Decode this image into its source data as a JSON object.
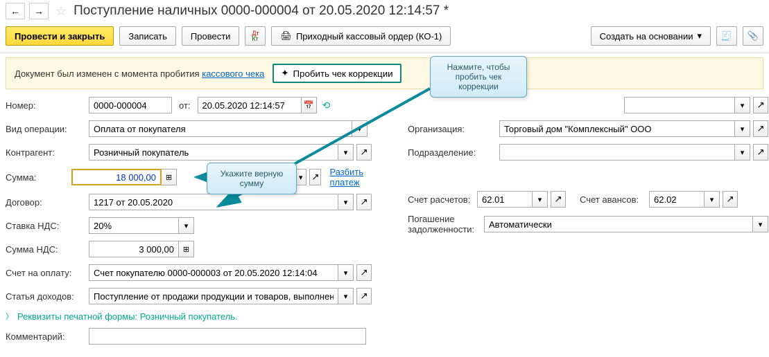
{
  "header": {
    "title": "Поступление наличных 0000-000004 от 20.05.2020 12:14:57 *"
  },
  "toolbar": {
    "save_close": "Провести и закрыть",
    "write": "Записать",
    "post": "Провести",
    "print_order": "Приходный кассовый ордер (КО-1)",
    "create_based": "Создать на основании"
  },
  "notice": {
    "text": "Документ был изменен с момента пробития ",
    "link": "кассового чека",
    "correction_btn": "Пробить чек коррекции"
  },
  "hints": {
    "correction": "Нажмите, чтобы пробить чек коррекции",
    "amount": "Укажите верную сумму"
  },
  "labels": {
    "number": "Номер:",
    "from": "от:",
    "op_type": "Вид операции:",
    "counterparty": "Контрагент:",
    "amount": "Сумма:",
    "contract": "Договор:",
    "vat_rate": "Ставка НДС:",
    "vat_amount": "Сумма НДС:",
    "invoice": "Счет на оплату:",
    "income_item": "Статья доходов:",
    "comment": "Комментарий:",
    "organization": "Организация:",
    "division": "Подразделение:",
    "acc_settle": "Счет расчетов:",
    "acc_advance": "Счет авансов:",
    "debt_repay": "Погашение задолженности:"
  },
  "values": {
    "number": "0000-000004",
    "date": "20.05.2020 12:14:57",
    "op_type": "Оплата от покупателя",
    "counterparty": "Розничный покупатель",
    "amount": "18 000,00",
    "contract": "1217 от 20.05.2020",
    "vat_rate": "20%",
    "vat_amount": "3 000,00",
    "invoice": "Счет покупателю 0000-000003 от 20.05.2020 12:14:04",
    "income_item": "Поступление от продажи продукции и товаров, выполнения",
    "comment": "",
    "organization": "Торговый дом \"Комплексный\" ООО",
    "division": "",
    "acc_settle": "62.01",
    "acc_advance": "62.02",
    "debt_repay": "Автоматически"
  },
  "links": {
    "split_payment": "Разбить платеж"
  },
  "collapse": {
    "print_req": "Реквизиты печатной формы: Розничный покупатель."
  }
}
